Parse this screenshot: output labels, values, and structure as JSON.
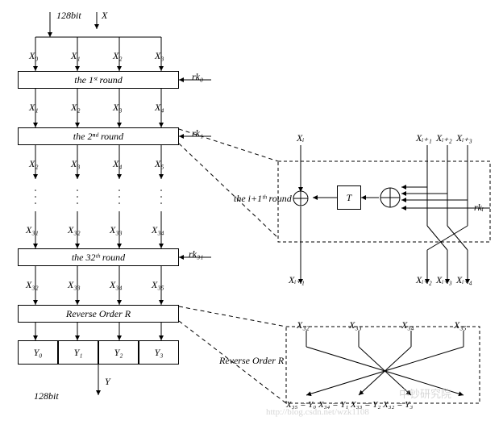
{
  "top": {
    "bits": "128bit",
    "X": "X",
    "inputs": [
      "X₀",
      "X₁",
      "X₂",
      "X₃"
    ]
  },
  "rounds": [
    {
      "label": "the  1ˢᵗ  round",
      "rk": "rk₀",
      "outs": [
        "X₁",
        "X₂",
        "X₃",
        "X₄"
      ]
    },
    {
      "label": "the  2ⁿᵈ  round",
      "rk": "rk₁",
      "outs": [
        "X₂",
        "X₃",
        "X₄",
        "X₅"
      ]
    },
    {
      "label": "the  32ᵗʰ  round",
      "rk": "rk₃₁",
      "outs_before": [
        "X₃₁",
        "X₃₂",
        "X₃₃",
        "X₃₄"
      ],
      "outs": [
        "X₃₂",
        "X₃₃",
        "X₃₄",
        "X₃₅"
      ]
    }
  ],
  "reverse": {
    "label": "Reverse Order R",
    "outs": [
      "Y₀",
      "Y₁",
      "Y₂",
      "Y₃"
    ],
    "Y": "Y",
    "bits": "128bit"
  },
  "detail_round": {
    "title": "the  i+1ᵗʰ  round",
    "Xi": "Xᵢ",
    "ins": [
      "Xᵢ₊₁",
      "Xᵢ₊₂",
      "Xᵢ₊₃"
    ],
    "T": "T",
    "rk": "rkᵢ",
    "outs": [
      "Xᵢ₊₁",
      "Xᵢ₊₂",
      "Xᵢ₊₃",
      "Xᵢ₊₄"
    ]
  },
  "detail_reverse": {
    "label": "Reverse Order R",
    "ins": [
      "X₃₂",
      "X₃₃",
      "X₃₄",
      "X₃₅"
    ],
    "bottom": "X₃₅ = Y₀   X₃₄ = Y₁    X₃₃ = Y₂    X₃₂ = Y₃"
  },
  "watermarks": [
    "http://blog.csdn.net/wzk1108",
    "中钞研究院"
  ]
}
